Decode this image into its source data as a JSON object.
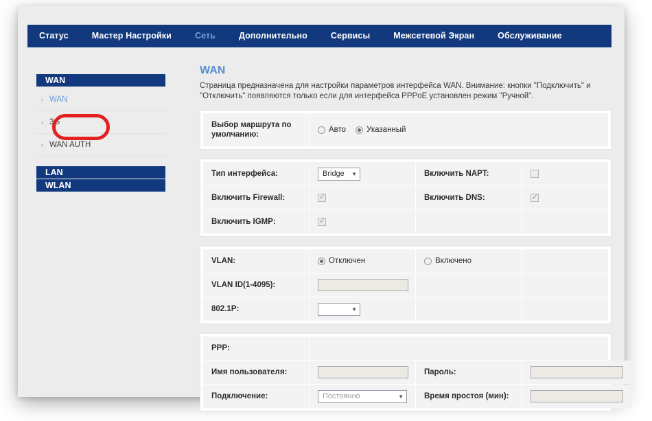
{
  "navbar": {
    "items": [
      {
        "label": "Статус",
        "active": false
      },
      {
        "label": "Мастер Настройки",
        "active": false
      },
      {
        "label": "Сеть",
        "active": true
      },
      {
        "label": "Дополнительно",
        "active": false
      },
      {
        "label": "Сервисы",
        "active": false
      },
      {
        "label": "Межсетевой Экран",
        "active": false
      },
      {
        "label": "Обслуживание",
        "active": false
      }
    ]
  },
  "sidebar": {
    "wan_header": "WAN",
    "items": [
      {
        "label": "WAN",
        "current": true
      },
      {
        "label": "3G",
        "current": false
      },
      {
        "label": "WAN AUTH",
        "current": false
      }
    ],
    "lan_header": "LAN",
    "wlan_header": "WLAN",
    "arrow_glyph": "›"
  },
  "annotation": {
    "color": "#e41f1f",
    "target": "3G"
  },
  "main": {
    "title": "WAN",
    "description": "Страница предназначена для настройки параметров интерфейса WAN. Внимание: кнопки \"Подключить\" и \"Отключить\" появляются только если для интерфейса PPPoE установлен режим \"Ручной\".",
    "route_panel": {
      "label": "Выбор маршрута по умолчанию:",
      "option_auto": "Авто",
      "option_specified": "Указанный",
      "selected": "Указанный"
    },
    "interface_panel": {
      "iface_type_label": "Тип интерфейса:",
      "iface_type_value": "Bridge",
      "napt_label": "Включить NAPT:",
      "napt_checked": false,
      "firewall_label": "Включить Firewall:",
      "firewall_checked": true,
      "dns_label": "Включить DNS:",
      "dns_checked": true,
      "igmp_label": "Включить IGMP:",
      "igmp_checked": true
    },
    "vlan_panel": {
      "vlan_label": "VLAN:",
      "vlan_off": "Отключен",
      "vlan_on": "Включено",
      "vlan_selected": "Отключен",
      "vlan_id_label": "VLAN ID(1-4095):",
      "vlan_id_value": "",
      "dot1p_label": "802.1P:",
      "dot1p_value": ""
    },
    "ppp_panel": {
      "ppp_label": "PPP:",
      "username_label": "Имя пользователя:",
      "username_value": "",
      "password_label": "Пароль:",
      "password_value": "",
      "connection_label": "Подключение:",
      "connection_value": "Постоянно",
      "idle_label": "Время простоя (мин):",
      "idle_value": ""
    }
  },
  "colors": {
    "navy": "#12397e",
    "accent_blue": "#5a8fd0",
    "annotation_red": "#e41f1f",
    "page_bg": "#ececec"
  }
}
